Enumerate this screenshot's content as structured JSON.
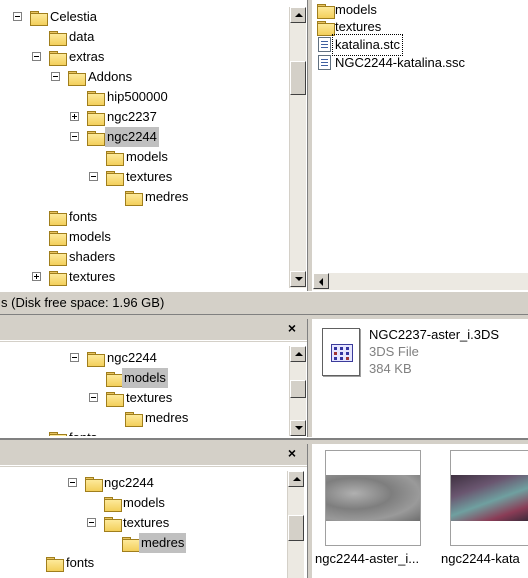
{
  "top_tree": {
    "items": [
      {
        "label": "Celestia",
        "expander": "minus"
      },
      {
        "label": "data",
        "expander": ""
      },
      {
        "label": "extras",
        "expander": "minus"
      },
      {
        "label": "Addons",
        "expander": "minus"
      },
      {
        "label": "hip500000",
        "expander": ""
      },
      {
        "label": "ngc2237",
        "expander": "plus"
      },
      {
        "label": "ngc2244",
        "expander": "minus",
        "selected": true
      },
      {
        "label": "models",
        "expander": ""
      },
      {
        "label": "textures",
        "expander": "minus"
      },
      {
        "label": "medres",
        "expander": ""
      },
      {
        "label": "fonts",
        "expander": ""
      },
      {
        "label": "models",
        "expander": ""
      },
      {
        "label": "shaders",
        "expander": ""
      },
      {
        "label": "textures",
        "expander": "plus"
      }
    ]
  },
  "top_files": {
    "items": [
      {
        "label": "models",
        "icon": "folder-icon"
      },
      {
        "label": "textures",
        "icon": "folder-icon"
      },
      {
        "label": "katalina.stc",
        "icon": "file-icon",
        "focused": true
      },
      {
        "label": "NGC2244-katalina.ssc",
        "icon": "file-icon"
      }
    ]
  },
  "status": {
    "text": "s (Disk free space: 1.96 GB)"
  },
  "middle_tree": {
    "close_label": "×",
    "items": [
      {
        "label": "ngc2244",
        "expander": "minus"
      },
      {
        "label": "models",
        "expander": "",
        "selected": true
      },
      {
        "label": "textures",
        "expander": "minus"
      },
      {
        "label": "medres",
        "expander": ""
      },
      {
        "label": "fonts",
        "expander": ""
      }
    ]
  },
  "middle_file": {
    "name": "NGC2237-aster_i.3DS",
    "type": "3DS File",
    "size": "384 KB"
  },
  "bottom_tree": {
    "close_label": "×",
    "items": [
      {
        "label": "ngc2244",
        "expander": "minus"
      },
      {
        "label": "models",
        "expander": ""
      },
      {
        "label": "textures",
        "expander": "minus"
      },
      {
        "label": "medres",
        "expander": "",
        "selected": true
      },
      {
        "label": "fonts",
        "expander": ""
      }
    ]
  },
  "bottom_thumbnails": [
    {
      "caption": "ngc2244-aster_i...",
      "color": "#8a8a8a"
    },
    {
      "caption": "ngc2244-kata",
      "color": "#5a4a5a"
    }
  ]
}
